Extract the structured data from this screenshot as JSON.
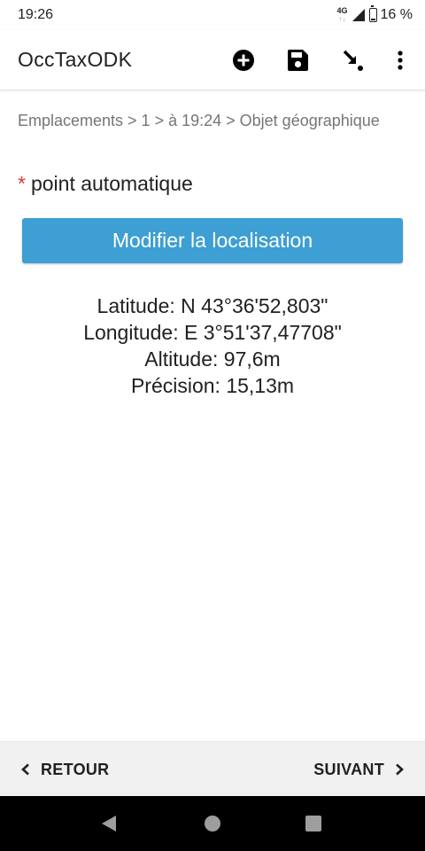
{
  "status_bar": {
    "time": "19:26",
    "network": "4G",
    "network_arrows": "↑↓",
    "battery": "16 %"
  },
  "app_bar": {
    "title": "OccTaxODK",
    "icons": [
      "add-circle-icon",
      "save-icon",
      "jump-arrow-icon",
      "more-vert-icon"
    ]
  },
  "form": {
    "breadcrumb": "Emplacements > 1 > à 19:24 > Objet géographique",
    "required_marker": "*",
    "question_label": "point automatique",
    "modify_button_label": "Modifier la localisation",
    "location": {
      "latitude": "Latitude: N 43°36'52,803\"",
      "longitude": "Longitude: E 3°51'37,47708\"",
      "altitude": "Altitude: 97,6m",
      "precision": "Précision: 15,13m"
    }
  },
  "bottom_nav": {
    "back_label": "RETOUR",
    "next_label": "SUIVANT"
  },
  "colors": {
    "accent": "#3d9fd3",
    "required": "#e53935",
    "breadcrumb": "#757575"
  }
}
